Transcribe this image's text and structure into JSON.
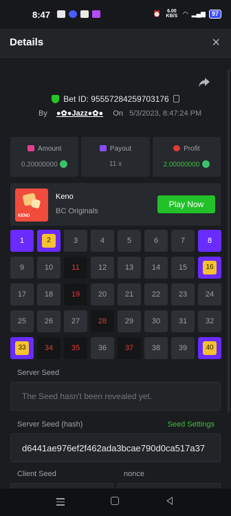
{
  "status_bar": {
    "time": "8:47",
    "speed": "6.00 KB/S",
    "battery": "97",
    "icons": [
      "notification-icon",
      "app-icon",
      "home-icon",
      "app-icon",
      "alarm-icon",
      "wifi-icon",
      "signal-icon",
      "battery-icon"
    ]
  },
  "header": {
    "title": "Details",
    "close_icon": "×"
  },
  "bet": {
    "id_label": "Bet ID: 95557284259703176",
    "by_label": "By",
    "user": "●✿●Jazz●✿●",
    "on_label": "On",
    "date": "5/3/2023, 8:47:24 PM"
  },
  "stats": {
    "amount_label": "Amount",
    "amount_value": "0.20000000",
    "payout_label": "Payout",
    "payout_value": "11 x",
    "profit_label": "Profit",
    "profit_value": "2.00000000"
  },
  "game": {
    "thumb_text": "KENO",
    "name": "Keno",
    "provider": "BC Originals",
    "play_label": "Play Now"
  },
  "board": {
    "numbers": [
      "1",
      "2",
      "3",
      "4",
      "5",
      "6",
      "7",
      "8",
      "9",
      "10",
      "11",
      "12",
      "13",
      "14",
      "15",
      "16",
      "17",
      "18",
      "19",
      "20",
      "21",
      "22",
      "23",
      "24",
      "25",
      "26",
      "27",
      "28",
      "29",
      "30",
      "31",
      "32",
      "33",
      "34",
      "35",
      "36",
      "37",
      "38",
      "39",
      "40"
    ],
    "picked": [
      1,
      8
    ],
    "hits": [
      2,
      16,
      33,
      40
    ],
    "misses": [
      11,
      19,
      28,
      34,
      35,
      37
    ]
  },
  "seeds": {
    "server_seed_label": "Server Seed",
    "server_seed_placeholder": "The Seed hasn't been revealed yet.",
    "server_hash_label": "Server Seed (hash)",
    "seed_settings_label": "Seed Settings",
    "server_hash_value": "d6441ae976ef2f462ada3bcae790d0ca517a37",
    "client_seed_label": "Client Seed",
    "nonce_label": "nonce"
  },
  "colors": {
    "accent_purple": "#6a2bff",
    "hit_gold": "#f5c230",
    "miss_red": "#e23b36",
    "green": "#22c12a"
  }
}
